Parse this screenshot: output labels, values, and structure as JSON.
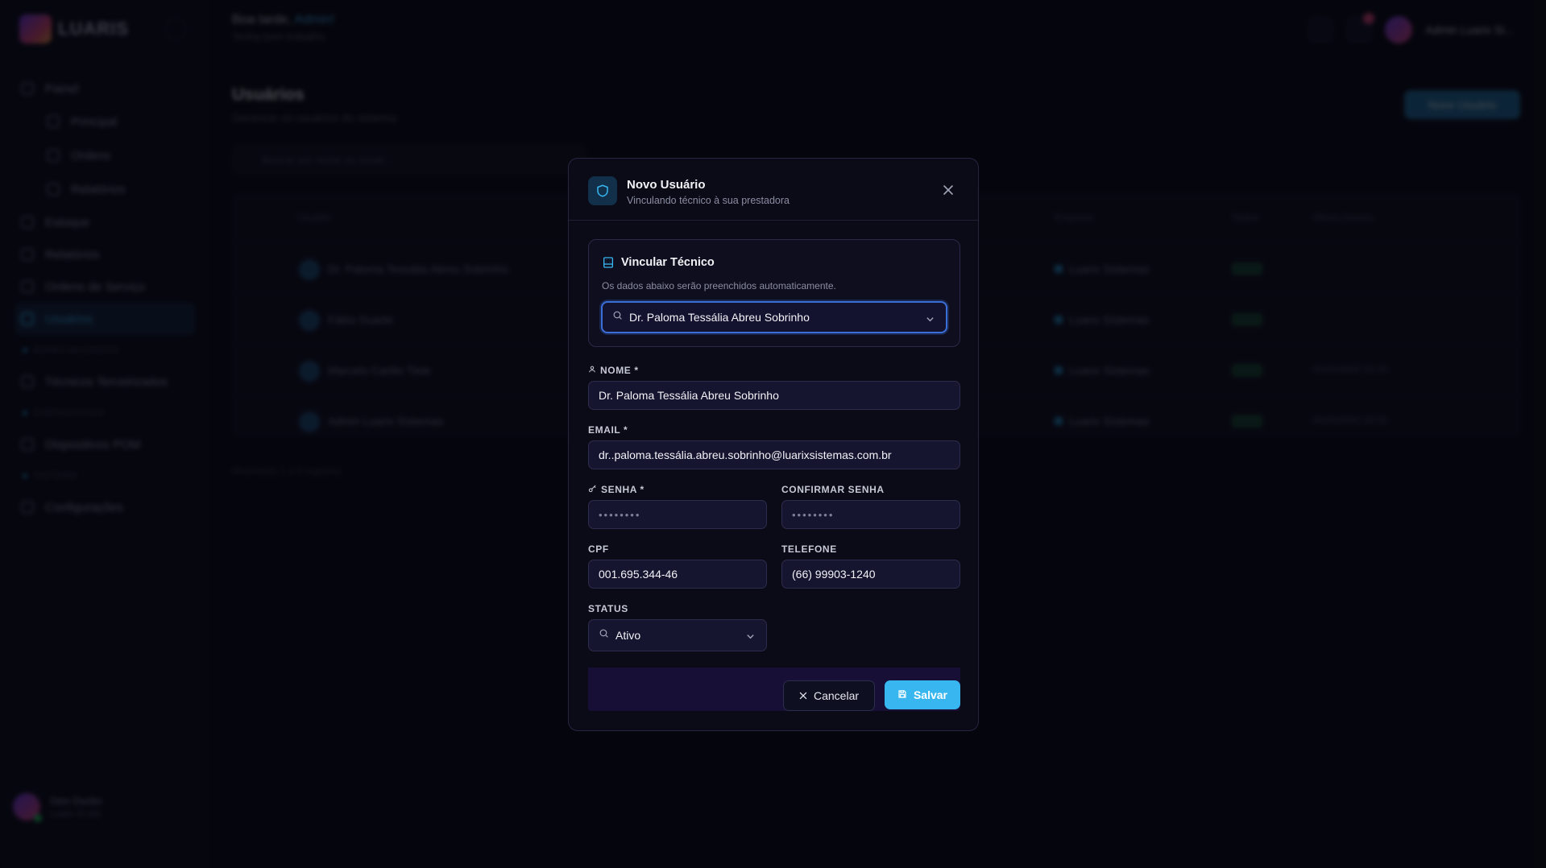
{
  "background": {
    "logo_text": "LUARIS",
    "greeting_prefix": "Boa tarde,",
    "greeting_name": "Admin!",
    "greeting_sub": "Tenha bom trabalho",
    "user_name": "Admin Luarix Si...",
    "page_title": "Usuários",
    "page_subtitle": "Gerencie os usuários do sistema",
    "new_button": "Novo Usuário",
    "search_placeholder": "Buscar por nome ou email...",
    "sidebar": {
      "painel": "Painel",
      "principal": "Principal",
      "ordens": "Ordens",
      "relatorios_sub": "Relatórios",
      "estoque": "Estoque",
      "relatorios": "Relatórios",
      "ordens_servico": "Ordens de Serviço",
      "usuarios": "Usuários",
      "section_1": "Especializados",
      "tecnicos": "Técnicos Terceirizados",
      "section_2": "Dispositivos",
      "dispositivos": "Dispositivos POM",
      "section_3": "Sistema",
      "configuracoes": "Configurações",
      "user_name": "Geo Ducks",
      "user_role": "Luarix Si (Al)"
    },
    "table": {
      "col_user": "Usuário",
      "col_company": "Empresa",
      "col_status": "Status",
      "col_last": "Último Acesso",
      "rows": [
        {
          "name": "Dr. Paloma Tessália Abreu Sobrinho",
          "company": "Luarix Sistemas",
          "date": ""
        },
        {
          "name": "Fábio Duarte",
          "company": "Luarix Sistemas",
          "date": ""
        },
        {
          "name": "Marcelo Carlito Tiele",
          "company": "Luarix Sistemas",
          "date": "00/00/0000 00:00"
        },
        {
          "name": "Admin Luarix Sistemas",
          "company": "Luarix Sistemas",
          "date": "00/00/0000 00:00"
        }
      ],
      "pager": "Mostrando 1 a 4 registros"
    }
  },
  "modal": {
    "title": "Novo Usuário",
    "subtitle": "Vinculando técnico à sua prestadora",
    "vincular": {
      "title": "Vincular Técnico",
      "description": "Os dados abaixo serão preenchidos automaticamente.",
      "selected": "Dr. Paloma Tessália Abreu Sobrinho"
    },
    "fields": {
      "nome_label": "NOME *",
      "nome_value": "Dr. Paloma Tessália Abreu Sobrinho",
      "email_label": "EMAIL *",
      "email_value": "dr..paloma.tessália.abreu.sobrinho@luarixsistemas.com.br",
      "senha_label": "SENHA *",
      "senha_value": "••••••••",
      "confirmar_label": "CONFIRMAR SENHA",
      "confirmar_value": "••••••••",
      "cpf_label": "CPF",
      "cpf_value": "001.695.344-46",
      "telefone_label": "TELEFONE",
      "telefone_value": "(66) 99903-1240",
      "status_label": "STATUS",
      "status_value": "Ativo"
    },
    "cancel_label": "Cancelar",
    "save_label": "Salvar"
  },
  "colors": {
    "accent": "#37b6f0",
    "focus_ring": "#3b6fd8",
    "modal_bg": "#0b0b18",
    "footer_bg": "#170f36"
  }
}
